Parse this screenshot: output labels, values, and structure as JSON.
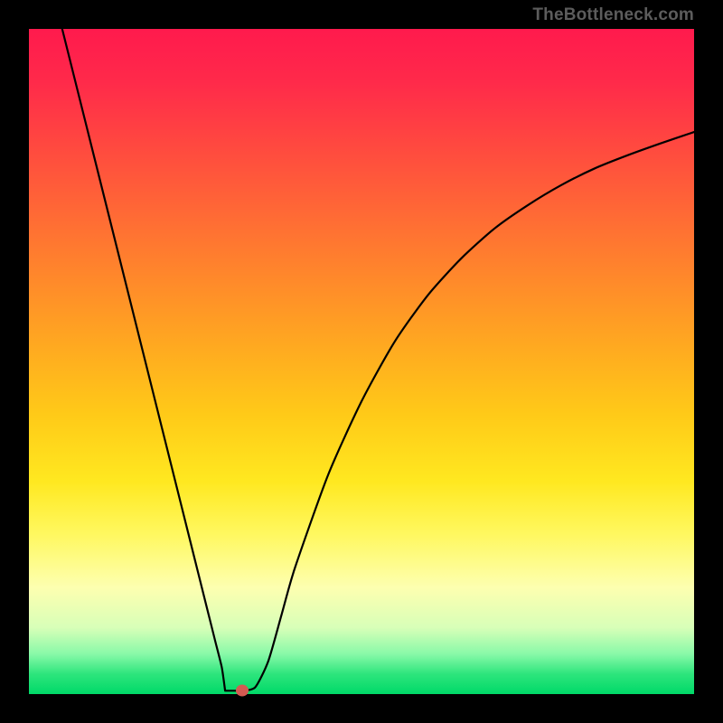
{
  "attribution": "TheBottleneck.com",
  "colors": {
    "background": "#000000",
    "top": "#ff1a4d",
    "bottom": "#00d968",
    "curve": "#000000",
    "marker": "#d45a52"
  },
  "chart_data": {
    "type": "line",
    "title": "",
    "xlabel": "",
    "ylabel": "",
    "xlim": [
      0,
      100
    ],
    "ylim": [
      0,
      100
    ],
    "x": [
      5,
      10,
      15,
      20,
      23,
      25,
      27,
      28,
      29,
      30,
      31,
      32,
      34,
      36,
      38,
      40,
      45,
      50,
      55,
      60,
      65,
      70,
      75,
      80,
      85,
      90,
      95,
      100
    ],
    "values": [
      100,
      80,
      60,
      40,
      28,
      20,
      12,
      8,
      4,
      2,
      1,
      0.5,
      1,
      5,
      12,
      19,
      33,
      44,
      53,
      60,
      65.5,
      70,
      73.5,
      76.5,
      79,
      81,
      82.8,
      84.5
    ],
    "marker": {
      "x": 32,
      "y": 0.5
    },
    "flat_min_segment": {
      "x_start": 29.5,
      "x_end": 32,
      "y": 0.5
    }
  }
}
